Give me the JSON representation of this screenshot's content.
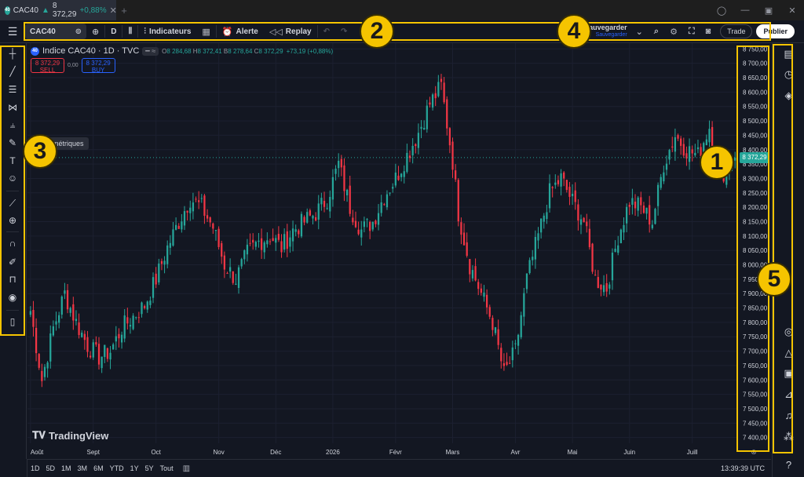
{
  "titlebar": {
    "tab_symbol": "CAC40",
    "tab_logo": "40",
    "tab_price": "8 372,29",
    "tab_change": "+0,88%",
    "tab_change_arrow": "▲"
  },
  "toolbar": {
    "symbol": "CAC40",
    "interval": "D",
    "indicators_label": "Indicateurs",
    "alert_label": "Alerte",
    "replay_label": "Replay",
    "save_label": "Sauvegarder",
    "save_sub": "Sauvegarder",
    "trade_label": "Trade",
    "publish_label": "Publier"
  },
  "legend": {
    "logo": "40",
    "title": "Indice CAC40 · 1D · TVC",
    "open_label": "O",
    "open": "8 284,68",
    "high_label": "H",
    "high": "8 372,41",
    "low_label": "B",
    "low": "8 278,64",
    "close_label": "C",
    "close": "8 372,29",
    "change": "+73,19 (+0,88%)",
    "sell_price": "8 372,29",
    "sell_label": "SELL",
    "spread": "0,00",
    "buy_price": "8 372,29",
    "buy_label": "BUY"
  },
  "tooltip": "ométriques",
  "brand": "TradingView",
  "last_price": "8 372,29",
  "bottombar": {
    "timeframes": [
      "1D",
      "5D",
      "1M",
      "3M",
      "6M",
      "YTD",
      "1Y",
      "5Y",
      "Tout"
    ],
    "clock": "13:39:39 UTC"
  },
  "annotations": [
    "1",
    "2",
    "3",
    "4",
    "5"
  ],
  "colors": {
    "up": "#26a69a",
    "down": "#f23645",
    "background": "#131722",
    "annotation": "#f5c400"
  },
  "chart_data": {
    "type": "candlestick",
    "y_ticks": [
      "8 750,00",
      "8 700,00",
      "8 650,00",
      "8 600,00",
      "8 550,00",
      "8 500,00",
      "8 450,00",
      "8 400,00",
      "8 350,00",
      "8 300,00",
      "8 250,00",
      "8 200,00",
      "8 150,00",
      "8 100,00",
      "8 050,00",
      "8 000,00",
      "7 950,00",
      "7 900,00",
      "7 850,00",
      "7 800,00",
      "7 750,00",
      "7 700,00",
      "7 650,00",
      "7 600,00",
      "7 550,00",
      "7 500,00",
      "7 450,00",
      "7 400,00"
    ],
    "ylim": [
      7380,
      8770
    ],
    "x_ticks": [
      "Août",
      "Sept",
      "Oct",
      "Nov",
      "Déc",
      "2026",
      "Févr",
      "Mars",
      "Avr",
      "Mai",
      "Juin",
      "Juill"
    ],
    "x_tick_index": [
      0,
      22,
      44,
      66,
      86,
      106,
      128,
      148,
      170,
      190,
      210,
      232
    ],
    "n_bars": 248,
    "close_anchors": [
      [
        0,
        7840
      ],
      [
        4,
        7600
      ],
      [
        8,
        7780
      ],
      [
        12,
        7900
      ],
      [
        16,
        7800
      ],
      [
        20,
        7720
      ],
      [
        24,
        7680
      ],
      [
        28,
        7700
      ],
      [
        32,
        7780
      ],
      [
        36,
        7820
      ],
      [
        40,
        7860
      ],
      [
        44,
        7950
      ],
      [
        48,
        8060
      ],
      [
        52,
        8150
      ],
      [
        56,
        8230
      ],
      [
        60,
        8200
      ],
      [
        64,
        8130
      ],
      [
        68,
        8000
      ],
      [
        72,
        7950
      ],
      [
        76,
        8040
      ],
      [
        80,
        8080
      ],
      [
        84,
        8100
      ],
      [
        88,
        8060
      ],
      [
        92,
        8120
      ],
      [
        96,
        8150
      ],
      [
        100,
        8180
      ],
      [
        104,
        8230
      ],
      [
        108,
        8350
      ],
      [
        112,
        8200
      ],
      [
        116,
        8120
      ],
      [
        120,
        8150
      ],
      [
        124,
        8240
      ],
      [
        128,
        8300
      ],
      [
        132,
        8380
      ],
      [
        136,
        8460
      ],
      [
        140,
        8560
      ],
      [
        144,
        8620
      ],
      [
        148,
        8360
      ],
      [
        150,
        8180
      ],
      [
        154,
        8000
      ],
      [
        158,
        7900
      ],
      [
        162,
        7800
      ],
      [
        166,
        7620
      ],
      [
        170,
        7700
      ],
      [
        174,
        7950
      ],
      [
        178,
        8100
      ],
      [
        182,
        8250
      ],
      [
        186,
        8300
      ],
      [
        190,
        8220
      ],
      [
        194,
        8150
      ],
      [
        198,
        7950
      ],
      [
        202,
        7920
      ],
      [
        206,
        8100
      ],
      [
        210,
        8220
      ],
      [
        214,
        8200
      ],
      [
        218,
        8150
      ],
      [
        222,
        8350
      ],
      [
        226,
        8450
      ],
      [
        230,
        8400
      ],
      [
        234,
        8380
      ],
      [
        238,
        8480
      ],
      [
        242,
        8310
      ],
      [
        247,
        8372
      ]
    ]
  }
}
